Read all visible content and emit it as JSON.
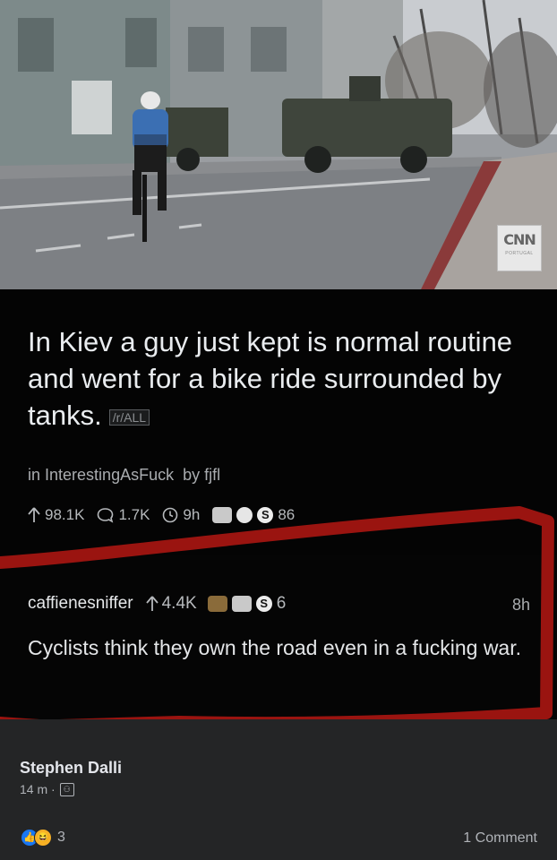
{
  "photo": {
    "watermark": "CNN",
    "watermark_sub": "PORTUGAL"
  },
  "post": {
    "title": "In Kiev a guy just kept is normal routine and went for a bike ride surrounded by tanks.",
    "tag": "/r/ALL",
    "meta_prefix": "in",
    "subreddit": "InterestingAsFuck",
    "meta_by": "by",
    "author": "fjfl",
    "upvotes": "98.1K",
    "comments": "1.7K",
    "age": "9h",
    "award_count": "86"
  },
  "comment": {
    "user": "caffienesniffer",
    "score": "4.4K",
    "award_count": "6",
    "time": "8h",
    "body": "Cyclists think they own the road even in a fucking war."
  },
  "fb": {
    "name": "Stephen Dalli",
    "time": "14 m ·",
    "reaction_count": "3",
    "comment_count": "1 Comment"
  },
  "colors": {
    "marker_red": "#9a1410",
    "fb_background": "#242526",
    "reddit_background": "#000000"
  },
  "icons": [
    "upvote-arrow-icon",
    "comment-bubble-icon",
    "clock-icon",
    "award-icon",
    "friends-icon",
    "like-reaction-icon",
    "haha-reaction-icon"
  ]
}
